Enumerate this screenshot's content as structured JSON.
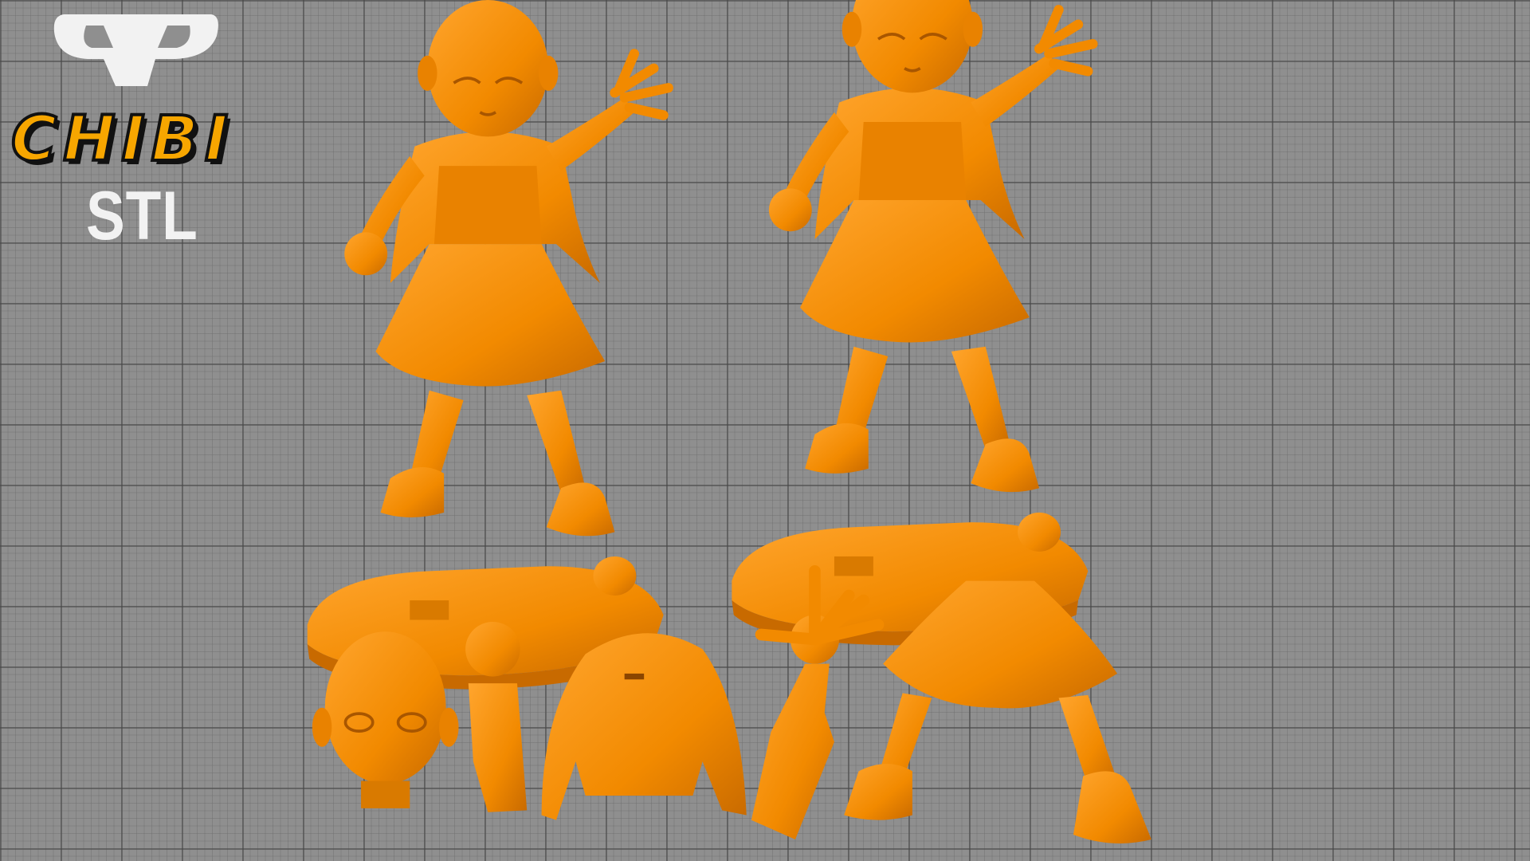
{
  "logo": {
    "brand_mark": "CP",
    "title": "CHIBI",
    "subtitle": "STL"
  },
  "colors": {
    "model": "#f28a00",
    "model_shadow": "#c86a00",
    "model_highlight": "#ffa52e",
    "grid_bg": "#8f8f8f",
    "logo_white": "#f2f2f2",
    "logo_orange": "#f7a600"
  },
  "scene": {
    "parts": [
      "assembled-figure-front",
      "assembled-figure-angle",
      "head",
      "fist-arm",
      "torso-jacket",
      "open-hand-arm",
      "skirt-legs"
    ]
  }
}
